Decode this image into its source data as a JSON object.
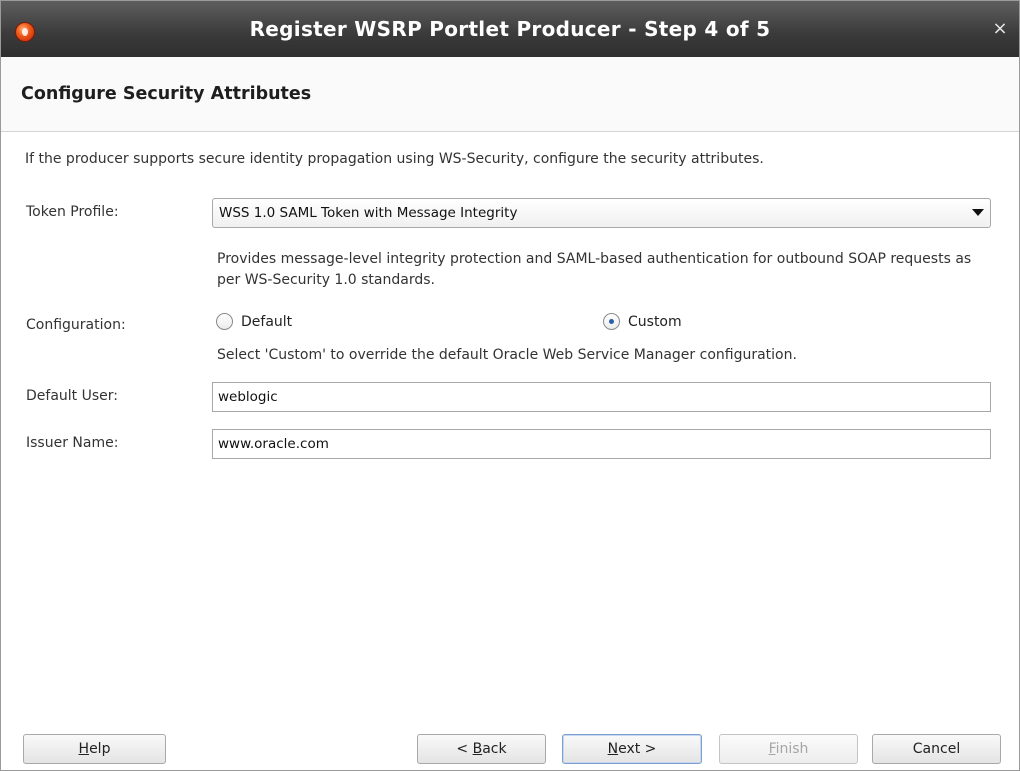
{
  "window": {
    "title": "Register WSRP Portlet Producer - Step 4 of 5",
    "close_symbol": "×"
  },
  "header": {
    "title": "Configure Security Attributes"
  },
  "main": {
    "intro": "If the producer supports secure identity propagation using WS-Security, configure the security attributes.",
    "token_profile": {
      "label": "Token Profile:",
      "value": "WSS 1.0 SAML Token with Message Integrity",
      "description": "Provides message-level integrity protection and SAML-based authentication for outbound SOAP requests as per WS-Security 1.0 standards."
    },
    "configuration": {
      "label": "Configuration:",
      "options": [
        {
          "label": "Default",
          "selected": false
        },
        {
          "label": "Custom",
          "selected": true
        }
      ],
      "hint": "Select 'Custom' to override the default Oracle Web Service Manager configuration."
    },
    "default_user": {
      "label": "Default User:",
      "value": "weblogic"
    },
    "issuer_name": {
      "label": "Issuer Name:",
      "value": "www.oracle.com"
    }
  },
  "footer": {
    "help": {
      "mnemonic": "H",
      "rest": "elp"
    },
    "back": {
      "prefix": "< ",
      "mnemonic": "B",
      "rest": "ack"
    },
    "next": {
      "mnemonic": "N",
      "rest": "ext >"
    },
    "finish": {
      "mnemonic": "F",
      "rest": "inish",
      "enabled": false
    },
    "cancel": {
      "label": "Cancel"
    }
  },
  "colors": {
    "titlebar": "#3a3a3a",
    "radio_selected": "#2a5fa8",
    "default_button_border": "#7d9fcf"
  },
  "icons": [
    "oracle-app-icon",
    "close-icon",
    "dropdown-icon"
  ]
}
